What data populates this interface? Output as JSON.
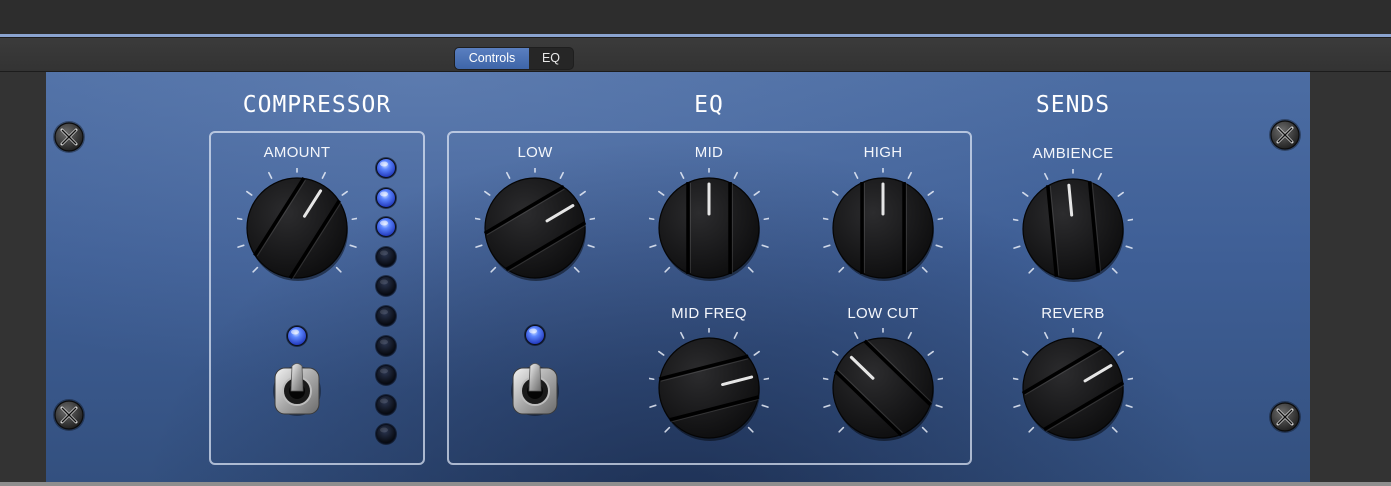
{
  "tabs": {
    "controls_label": "Controls",
    "eq_label": "EQ",
    "active": "Controls"
  },
  "colors": {
    "panel": "#3f5f96",
    "accent": "#8aa3cf",
    "led_on": "#3f6bff",
    "tab_active": "#4a70b4"
  },
  "sections": {
    "compressor": {
      "title": "COMPRESSOR",
      "amount": {
        "label": "AMOUNT",
        "value": 0.62
      },
      "switch_led": "on",
      "meter_leds": [
        "on",
        "on",
        "on",
        "off",
        "off",
        "off",
        "off",
        "off",
        "off",
        "off"
      ]
    },
    "eq": {
      "title": "EQ",
      "low": {
        "label": "LOW",
        "value": 0.72
      },
      "mid": {
        "label": "MID",
        "value": 0.5
      },
      "high": {
        "label": "HIGH",
        "value": 0.5
      },
      "mid_freq": {
        "label": "MID FREQ",
        "value": 0.78
      },
      "low_cut": {
        "label": "LOW CUT",
        "value": 0.33
      },
      "switch_led": "on"
    },
    "sends": {
      "title": "SENDS",
      "ambience": {
        "label": "AMBIENCE",
        "value": 0.48
      },
      "reverb": {
        "label": "REVERB",
        "value": 0.72
      }
    }
  }
}
